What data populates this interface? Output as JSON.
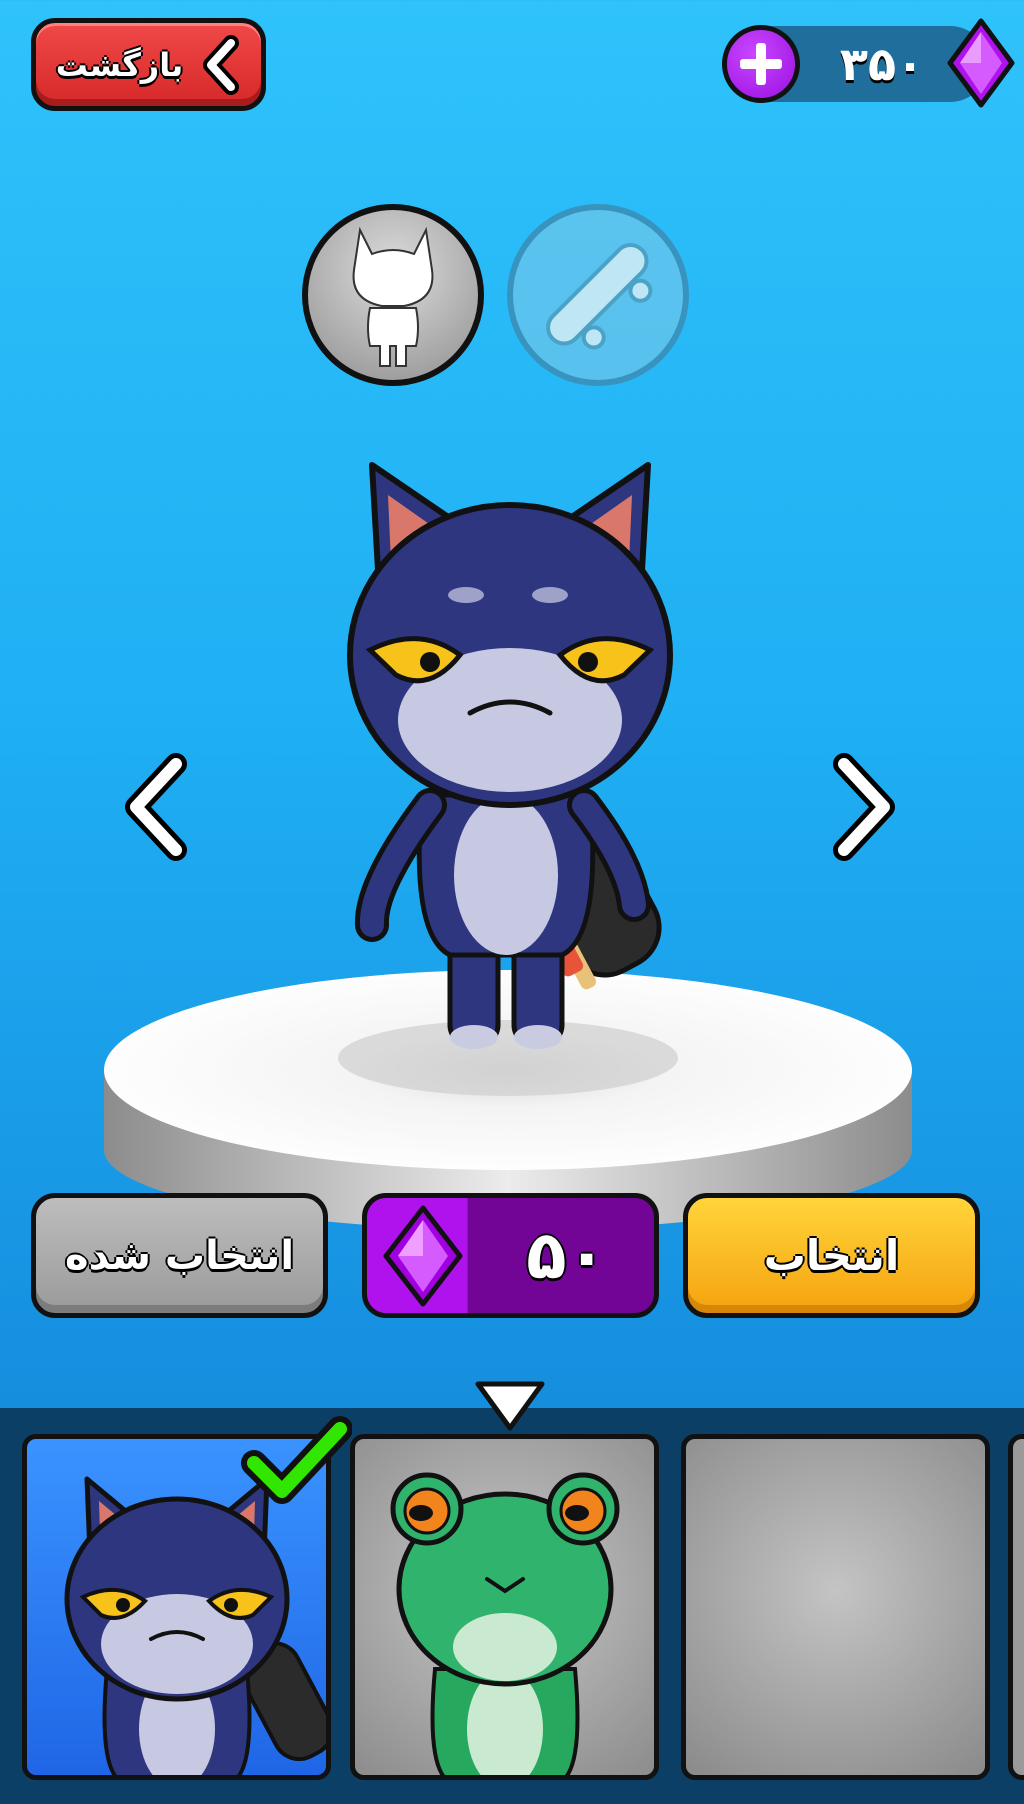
{
  "header": {
    "back_label": "بازگشت",
    "gems": "۳۵۰"
  },
  "modes": [
    {
      "name": "character",
      "active": true
    },
    {
      "name": "skateboard",
      "active": false
    }
  ],
  "preview": {
    "character": "navy-cat-with-skateboard"
  },
  "actions": {
    "selected_label": "انتخاب شده",
    "price": "۵۰",
    "select_label": "انتخاب"
  },
  "carousel": {
    "items": [
      {
        "character": "navy-cat",
        "owned": true,
        "selected": true
      },
      {
        "character": "green-frog",
        "owned": false,
        "selected": false
      },
      {
        "character": "locked",
        "owned": false,
        "selected": false
      }
    ]
  },
  "colors": {
    "sky": "#2fc2fb",
    "back_button": "#d62929",
    "gem": "#b012ee",
    "select_button": "#f5a20f",
    "carousel_panel": "#0c3f66",
    "selected_check": "#31e600"
  }
}
